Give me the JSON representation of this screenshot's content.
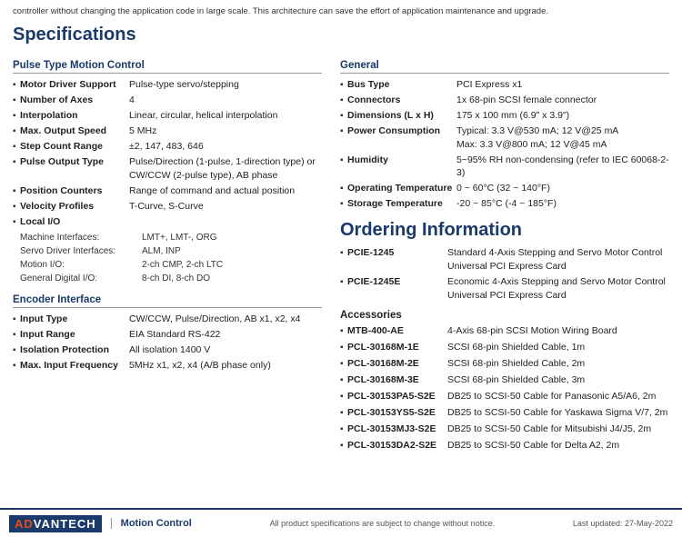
{
  "top_note": "controller without changing the application code in large scale. This architecture can save the effort of application maintenance and upgrade.",
  "specs_title": "Specifications",
  "ordering_title": "Ordering Information",
  "left": {
    "pulse_section": "Pulse Type Motion Control",
    "pulse_specs": [
      {
        "label": "Motor Driver Support",
        "value": "Pulse-type servo/stepping"
      },
      {
        "label": "Number of Axes",
        "value": "4"
      },
      {
        "label": "Interpolation",
        "value": "Linear, circular, helical interpolation"
      },
      {
        "label": "Max. Output Speed",
        "value": "5 MHz"
      },
      {
        "label": "Step Count Range",
        "value": "±2, 147, 483, 646"
      },
      {
        "label": "Pulse Output Type",
        "value": "Pulse/Direction (1-pulse, 1-direction type) or CW/CCW (2-pulse type), AB phase"
      },
      {
        "label": "Position Counters",
        "value": "Range of command and actual position"
      },
      {
        "label": "Velocity Profiles",
        "value": "T-Curve, S-Curve"
      },
      {
        "label": "Local I/O",
        "value": ""
      }
    ],
    "local_io_rows": [
      {
        "label": "Machine Interfaces:",
        "value": "LMT+, LMT-, ORG"
      },
      {
        "label": "Servo Driver Interfaces:",
        "value": "ALM, INP"
      },
      {
        "label": "Motion I/O:",
        "value": "2-ch CMP, 2-ch LTC"
      },
      {
        "label": "General Digital I/O:",
        "value": "8-ch DI, 8-ch DO"
      }
    ],
    "encoder_section": "Encoder Interface",
    "encoder_specs": [
      {
        "label": "Input Type",
        "value": "CW/CCW, Pulse/Direction, AB x1, x2, x4"
      },
      {
        "label": "Input Range",
        "value": "EIA Standard RS-422"
      },
      {
        "label": "Isolation Protection",
        "value": "All isolation 1400 V"
      },
      {
        "label": "Max. Input Frequency",
        "value": "5MHz x1, x2, x4 (A/B phase only)"
      }
    ]
  },
  "right": {
    "general_section": "General",
    "general_specs": [
      {
        "label": "Bus Type",
        "value": "PCI Express x1"
      },
      {
        "label": "Connectors",
        "value": "1x 68-pin SCSI female connector"
      },
      {
        "label": "Dimensions (L x H)",
        "value": "175 x 100 mm (6.9\" x 3.9\")"
      },
      {
        "label": "Power Consumption",
        "value": "Typical: 3.3 V@530 mA; 12 V@25 mA\nMax: 3.3 V@800 mA; 12 V@45 mA"
      },
      {
        "label": "Humidity",
        "value": "5~95% RH non-condensing (refer to IEC 60068-2-3)"
      },
      {
        "label": "Operating Temperature",
        "value": "0 ~ 60°C (32 ~ 140°F)"
      },
      {
        "label": "Storage Temperature",
        "value": "-20 ~ 85°C (-4 ~ 185°F)"
      }
    ],
    "ordering_items": [
      {
        "label": "PCIE-1245",
        "value": "Standard 4-Axis Stepping and Servo Motor Control Universal PCI Express Card"
      },
      {
        "label": "PCIE-1245E",
        "value": "Economic 4-Axis Stepping and Servo Motor Control Universal PCI Express Card"
      }
    ],
    "accessories_title": "Accessories",
    "accessories": [
      {
        "label": "MTB-400-AE",
        "value": "4-Axis 68-pin SCSI Motion Wiring Board"
      },
      {
        "label": "PCL-30168M-1E",
        "value": "SCSI 68-pin Shielded Cable, 1m"
      },
      {
        "label": "PCL-30168M-2E",
        "value": "SCSI 68-pin Shielded Cable, 2m"
      },
      {
        "label": "PCL-30168M-3E",
        "value": "SCSI 68-pin Shielded Cable, 3m"
      },
      {
        "label": "PCL-30153PA5-S2E",
        "value": "DB25 to SCSI-50 Cable for Panasonic A5/A6, 2m"
      },
      {
        "label": "PCL-30153YS5-S2E",
        "value": "DB25 to SCSI-50 Cable for Yaskawa Sigma V/7, 2m"
      },
      {
        "label": "PCL-30153MJ3-S2E",
        "value": "DB25 to SCSI-50 Cable for Mitsubishi J4/J5, 2m"
      },
      {
        "label": "PCL-30153DA2-S2E",
        "value": "DB25 to SCSI-50 Cable for Delta A2, 2m"
      }
    ]
  },
  "footer": {
    "logo": "AD▼NTECH",
    "logo_text": "ADVANTECH",
    "section": "Motion Control",
    "note": "All product specifications are subject to change without notice.",
    "date": "Last updated: 27-May-2022"
  }
}
